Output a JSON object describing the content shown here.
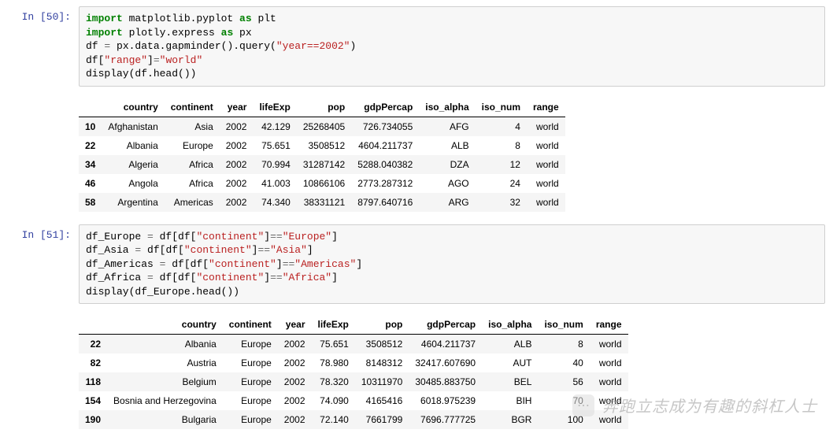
{
  "cells": [
    {
      "prompt": "In [50]:",
      "code_html": "<span class='kw-green'>import</span> matplotlib.pyplot <span class='kw-green'>as</span> plt\n<span class='kw-green'>import</span> plotly.express <span class='kw-green'>as</span> px\ndf <span class='op'>=</span> px.data.gapminder().query(<span class='str-red'>\"year==2002\"</span>)\ndf[<span class='str-red'>\"range\"</span>]<span class='op'>=</span><span class='str-red'>\"world\"</span>\ndisplay(df.head())",
      "table": {
        "columns": [
          "",
          "country",
          "continent",
          "year",
          "lifeExp",
          "pop",
          "gdpPercap",
          "iso_alpha",
          "iso_num",
          "range"
        ],
        "rows": [
          [
            "10",
            "Afghanistan",
            "Asia",
            "2002",
            "42.129",
            "25268405",
            "726.734055",
            "AFG",
            "4",
            "world"
          ],
          [
            "22",
            "Albania",
            "Europe",
            "2002",
            "75.651",
            "3508512",
            "4604.211737",
            "ALB",
            "8",
            "world"
          ],
          [
            "34",
            "Algeria",
            "Africa",
            "2002",
            "70.994",
            "31287142",
            "5288.040382",
            "DZA",
            "12",
            "world"
          ],
          [
            "46",
            "Angola",
            "Africa",
            "2002",
            "41.003",
            "10866106",
            "2773.287312",
            "AGO",
            "24",
            "world"
          ],
          [
            "58",
            "Argentina",
            "Americas",
            "2002",
            "74.340",
            "38331121",
            "8797.640716",
            "ARG",
            "32",
            "world"
          ]
        ]
      }
    },
    {
      "prompt": "In [51]:",
      "code_html": "df_Europe <span class='op'>=</span> df[df[<span class='str-red'>\"continent\"</span>]<span class='op'>==</span><span class='str-red'>\"Europe\"</span>]\ndf_Asia <span class='op'>=</span> df[df[<span class='str-red'>\"continent\"</span>]<span class='op'>==</span><span class='str-red'>\"Asia\"</span>]\ndf_Americas <span class='op'>=</span> df[df[<span class='str-red'>\"continent\"</span>]<span class='op'>==</span><span class='str-red'>\"Americas\"</span>]\ndf_Africa <span class='op'>=</span> df[df[<span class='str-red'>\"continent\"</span>]<span class='op'>==</span><span class='str-red'>\"Africa\"</span>]\ndisplay(df_Europe.head())",
      "table": {
        "columns": [
          "",
          "country",
          "continent",
          "year",
          "lifeExp",
          "pop",
          "gdpPercap",
          "iso_alpha",
          "iso_num",
          "range"
        ],
        "rows": [
          [
            "22",
            "Albania",
            "Europe",
            "2002",
            "75.651",
            "3508512",
            "4604.211737",
            "ALB",
            "8",
            "world"
          ],
          [
            "82",
            "Austria",
            "Europe",
            "2002",
            "78.980",
            "8148312",
            "32417.607690",
            "AUT",
            "40",
            "world"
          ],
          [
            "118",
            "Belgium",
            "Europe",
            "2002",
            "78.320",
            "10311970",
            "30485.883750",
            "BEL",
            "56",
            "world"
          ],
          [
            "154",
            "Bosnia and Herzegovina",
            "Europe",
            "2002",
            "74.090",
            "4165416",
            "6018.975239",
            "BIH",
            "70",
            "world"
          ],
          [
            "190",
            "Bulgaria",
            "Europe",
            "2002",
            "72.140",
            "7661799",
            "7696.777725",
            "BGR",
            "100",
            "world"
          ]
        ]
      }
    }
  ],
  "footer": {
    "text": "奔跑立志成为有趣的斜杠人士",
    "icon_glyph": "⋯"
  }
}
